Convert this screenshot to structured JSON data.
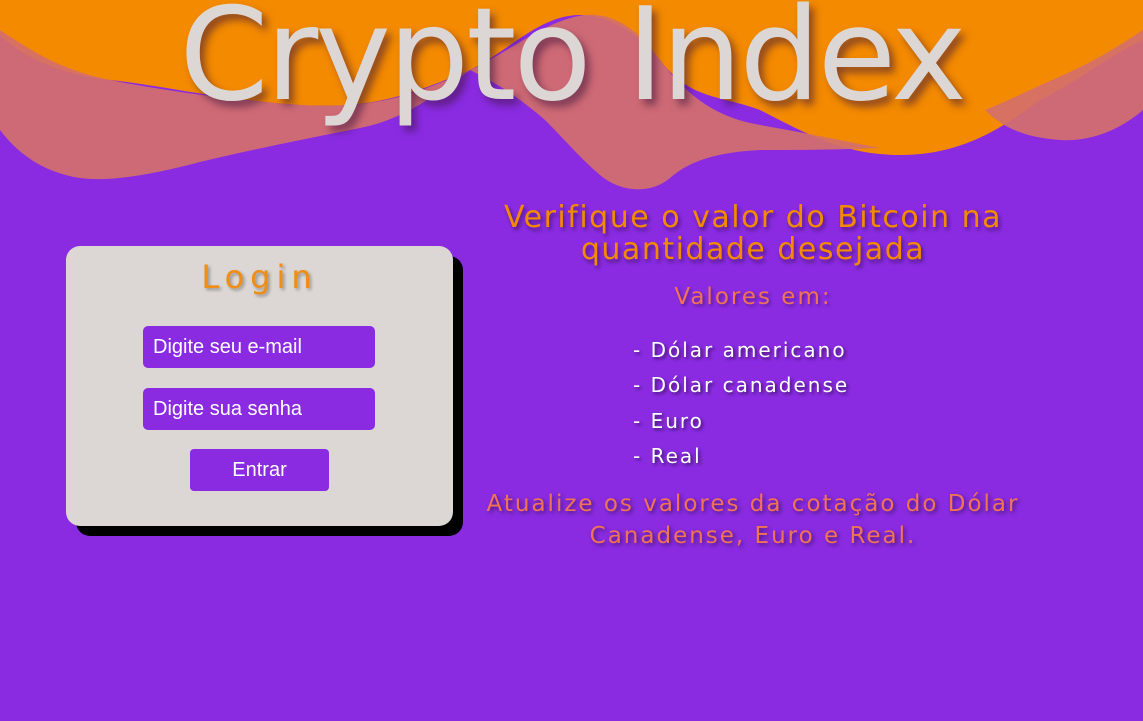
{
  "header": {
    "site_title": "Crypto Index"
  },
  "colors": {
    "background": "#8a2be2",
    "wave_orange": "#f48a00",
    "wave_salmon": "#d4706b",
    "card_background": "#dcd7d4",
    "accent_orange": "#ef8d14",
    "accent_salmon": "#f07356"
  },
  "login": {
    "title": "Login",
    "email_placeholder": "Digite seu e-mail",
    "password_placeholder": "Digite sua senha",
    "submit_label": "Entrar"
  },
  "info": {
    "heading": "Verifique o valor do Bitcoin na quantidade desejada",
    "values_label": "Valores em:",
    "currencies": [
      "- Dólar americano",
      "- Dólar canadense",
      "- Euro",
      "- Real"
    ],
    "update_note": "Atualize os valores da cotação do Dólar Canadense, Euro e Real."
  }
}
